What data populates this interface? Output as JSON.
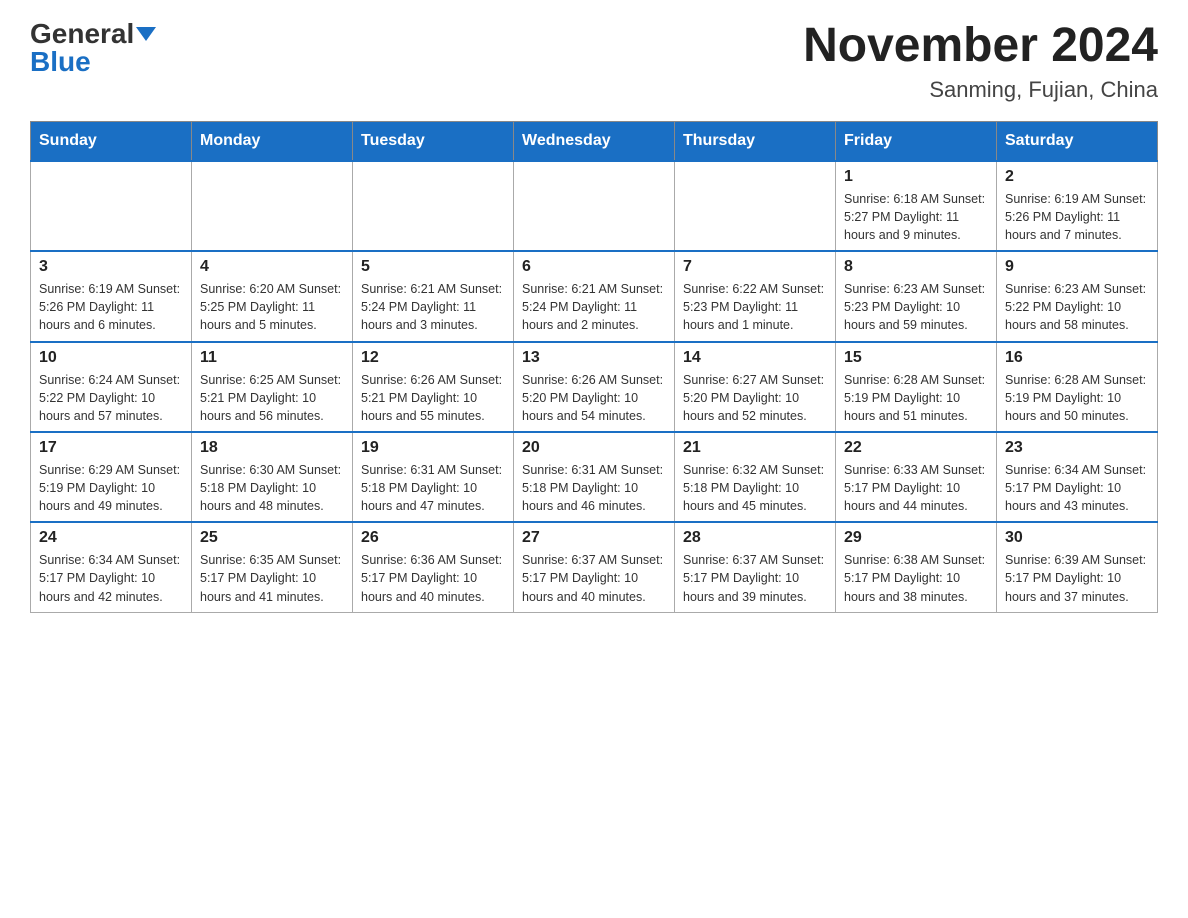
{
  "header": {
    "logo_general": "General",
    "logo_blue": "Blue",
    "title": "November 2024",
    "subtitle": "Sanming, Fujian, China"
  },
  "days_of_week": [
    "Sunday",
    "Monday",
    "Tuesday",
    "Wednesday",
    "Thursday",
    "Friday",
    "Saturday"
  ],
  "weeks": [
    {
      "days": [
        {
          "num": "",
          "info": ""
        },
        {
          "num": "",
          "info": ""
        },
        {
          "num": "",
          "info": ""
        },
        {
          "num": "",
          "info": ""
        },
        {
          "num": "",
          "info": ""
        },
        {
          "num": "1",
          "info": "Sunrise: 6:18 AM\nSunset: 5:27 PM\nDaylight: 11 hours and 9 minutes."
        },
        {
          "num": "2",
          "info": "Sunrise: 6:19 AM\nSunset: 5:26 PM\nDaylight: 11 hours and 7 minutes."
        }
      ]
    },
    {
      "days": [
        {
          "num": "3",
          "info": "Sunrise: 6:19 AM\nSunset: 5:26 PM\nDaylight: 11 hours and 6 minutes."
        },
        {
          "num": "4",
          "info": "Sunrise: 6:20 AM\nSunset: 5:25 PM\nDaylight: 11 hours and 5 minutes."
        },
        {
          "num": "5",
          "info": "Sunrise: 6:21 AM\nSunset: 5:24 PM\nDaylight: 11 hours and 3 minutes."
        },
        {
          "num": "6",
          "info": "Sunrise: 6:21 AM\nSunset: 5:24 PM\nDaylight: 11 hours and 2 minutes."
        },
        {
          "num": "7",
          "info": "Sunrise: 6:22 AM\nSunset: 5:23 PM\nDaylight: 11 hours and 1 minute."
        },
        {
          "num": "8",
          "info": "Sunrise: 6:23 AM\nSunset: 5:23 PM\nDaylight: 10 hours and 59 minutes."
        },
        {
          "num": "9",
          "info": "Sunrise: 6:23 AM\nSunset: 5:22 PM\nDaylight: 10 hours and 58 minutes."
        }
      ]
    },
    {
      "days": [
        {
          "num": "10",
          "info": "Sunrise: 6:24 AM\nSunset: 5:22 PM\nDaylight: 10 hours and 57 minutes."
        },
        {
          "num": "11",
          "info": "Sunrise: 6:25 AM\nSunset: 5:21 PM\nDaylight: 10 hours and 56 minutes."
        },
        {
          "num": "12",
          "info": "Sunrise: 6:26 AM\nSunset: 5:21 PM\nDaylight: 10 hours and 55 minutes."
        },
        {
          "num": "13",
          "info": "Sunrise: 6:26 AM\nSunset: 5:20 PM\nDaylight: 10 hours and 54 minutes."
        },
        {
          "num": "14",
          "info": "Sunrise: 6:27 AM\nSunset: 5:20 PM\nDaylight: 10 hours and 52 minutes."
        },
        {
          "num": "15",
          "info": "Sunrise: 6:28 AM\nSunset: 5:19 PM\nDaylight: 10 hours and 51 minutes."
        },
        {
          "num": "16",
          "info": "Sunrise: 6:28 AM\nSunset: 5:19 PM\nDaylight: 10 hours and 50 minutes."
        }
      ]
    },
    {
      "days": [
        {
          "num": "17",
          "info": "Sunrise: 6:29 AM\nSunset: 5:19 PM\nDaylight: 10 hours and 49 minutes."
        },
        {
          "num": "18",
          "info": "Sunrise: 6:30 AM\nSunset: 5:18 PM\nDaylight: 10 hours and 48 minutes."
        },
        {
          "num": "19",
          "info": "Sunrise: 6:31 AM\nSunset: 5:18 PM\nDaylight: 10 hours and 47 minutes."
        },
        {
          "num": "20",
          "info": "Sunrise: 6:31 AM\nSunset: 5:18 PM\nDaylight: 10 hours and 46 minutes."
        },
        {
          "num": "21",
          "info": "Sunrise: 6:32 AM\nSunset: 5:18 PM\nDaylight: 10 hours and 45 minutes."
        },
        {
          "num": "22",
          "info": "Sunrise: 6:33 AM\nSunset: 5:17 PM\nDaylight: 10 hours and 44 minutes."
        },
        {
          "num": "23",
          "info": "Sunrise: 6:34 AM\nSunset: 5:17 PM\nDaylight: 10 hours and 43 minutes."
        }
      ]
    },
    {
      "days": [
        {
          "num": "24",
          "info": "Sunrise: 6:34 AM\nSunset: 5:17 PM\nDaylight: 10 hours and 42 minutes."
        },
        {
          "num": "25",
          "info": "Sunrise: 6:35 AM\nSunset: 5:17 PM\nDaylight: 10 hours and 41 minutes."
        },
        {
          "num": "26",
          "info": "Sunrise: 6:36 AM\nSunset: 5:17 PM\nDaylight: 10 hours and 40 minutes."
        },
        {
          "num": "27",
          "info": "Sunrise: 6:37 AM\nSunset: 5:17 PM\nDaylight: 10 hours and 40 minutes."
        },
        {
          "num": "28",
          "info": "Sunrise: 6:37 AM\nSunset: 5:17 PM\nDaylight: 10 hours and 39 minutes."
        },
        {
          "num": "29",
          "info": "Sunrise: 6:38 AM\nSunset: 5:17 PM\nDaylight: 10 hours and 38 minutes."
        },
        {
          "num": "30",
          "info": "Sunrise: 6:39 AM\nSunset: 5:17 PM\nDaylight: 10 hours and 37 minutes."
        }
      ]
    }
  ]
}
